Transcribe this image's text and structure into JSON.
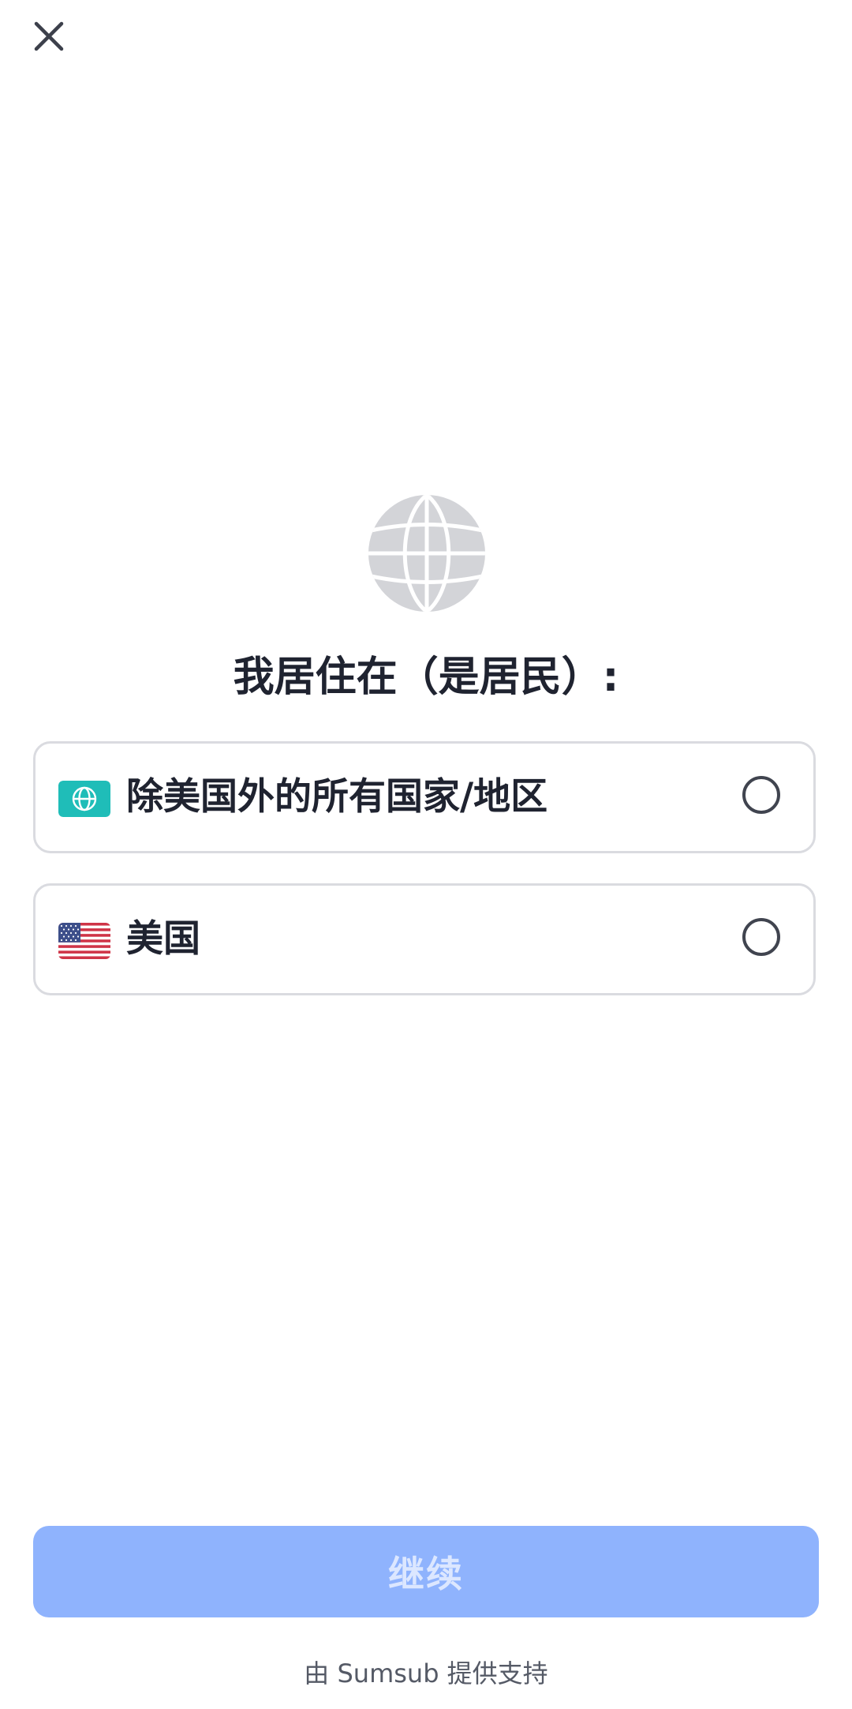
{
  "header": {
    "close_icon": "close-icon"
  },
  "hero": {
    "icon": "globe-icon",
    "icon_color": "#d3d4d8"
  },
  "title": "我居住在（是居民）:",
  "options": [
    {
      "label": "除美国外的所有国家/地区",
      "icon": "globe-badge-icon",
      "icon_color": "#1fbdb8",
      "selected": false
    },
    {
      "label": "美国",
      "icon": "us-flag-icon",
      "selected": false
    }
  ],
  "continue_button": {
    "label": "继续",
    "enabled": false,
    "color": "#8fb3fd"
  },
  "footer": {
    "text": "由 Sumsub 提供支持"
  }
}
